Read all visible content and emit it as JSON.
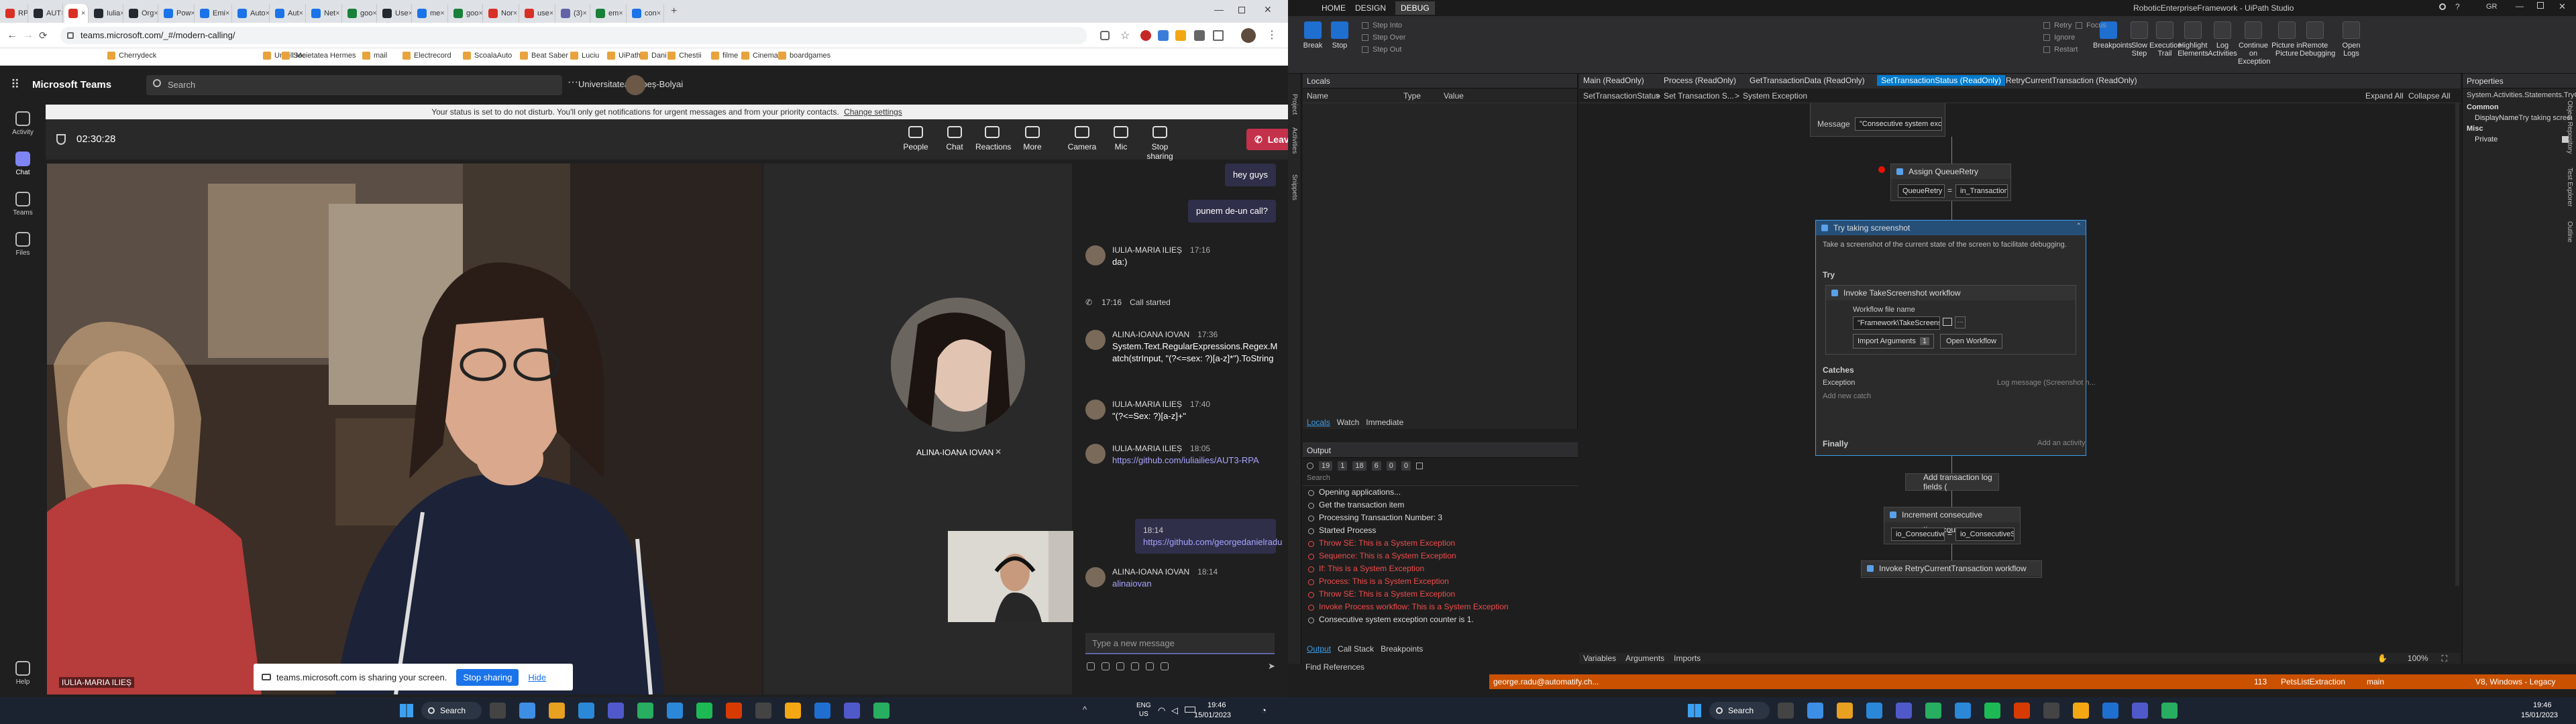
{
  "browser": {
    "tabs": [
      {
        "label": "RPA",
        "color": "#d93025"
      },
      {
        "label": "AUT",
        "color": "#24292f"
      },
      {
        "label": "",
        "color": "#d93025"
      },
      {
        "label": "Iulia",
        "color": "#24292f"
      },
      {
        "label": "Org",
        "color": "#24292f"
      },
      {
        "label": "Pow",
        "color": "#1a73e8"
      },
      {
        "label": "Emi",
        "color": "#1a73e8"
      },
      {
        "label": "Auto",
        "color": "#1a73e8"
      },
      {
        "label": "Aut",
        "color": "#1a73e8"
      },
      {
        "label": "Net",
        "color": "#1a73e8"
      },
      {
        "label": "goo",
        "color": "#188038"
      },
      {
        "label": "Use",
        "color": "#24292f"
      },
      {
        "label": "me",
        "color": "#1a73e8"
      },
      {
        "label": "goo",
        "color": "#188038"
      },
      {
        "label": "Nor",
        "color": "#d93025"
      },
      {
        "label": "use",
        "color": "#d93025"
      },
      {
        "label": "(3)",
        "color": "#6264a7"
      },
      {
        "label": "em",
        "color": "#188038"
      },
      {
        "label": "con",
        "color": "#1a73e8"
      }
    ],
    "url": "teams.microsoft.com/_#/modern-calling/",
    "bookmarks": [
      "Cherrydeck",
      "Unroll.Me",
      "Societatea Hermes",
      "mail",
      "Electrecord",
      "ScoalaAuto",
      "Beat Saber",
      "Luciu",
      "UiPath",
      "Dani",
      "Chestii",
      "filme",
      "Cinema",
      "boardgames"
    ]
  },
  "teams": {
    "app_name": "Microsoft Teams",
    "search_placeholder": "Search",
    "org": "Universitatea Babeș-Bolyai",
    "rail": [
      "Activity",
      "Chat",
      "Teams",
      "Files",
      "Help"
    ],
    "status_banner": "Your status is set to do not disturb. You'll only get notifications for urgent messages and from your priority contacts.",
    "status_link": "Change settings",
    "timer": "02:30:28",
    "controls": [
      "People",
      "Chat",
      "Reactions",
      "More",
      "Camera",
      "Mic",
      "Stop sharing"
    ],
    "leave_label": "Leave",
    "participant_main": "IULIA-MARIA ILIEȘ",
    "participant_side": "ALINA-IOANA IOVAN",
    "share_notice": "teams.microsoft.com is sharing your screen.",
    "stop_sharing": "Stop sharing",
    "hide": "Hide",
    "compose_placeholder": "Type a new message",
    "chat": [
      {
        "type": "mine",
        "text": "hey guys"
      },
      {
        "type": "mine",
        "text": "punem de-un call?"
      },
      {
        "type": "msg",
        "author": "IULIA-MARIA ILIEȘ",
        "time": "17:16",
        "text": "da:)"
      },
      {
        "type": "event",
        "time": "17:16",
        "text": "Call started"
      },
      {
        "type": "msg",
        "author": "ALINA-IOANA IOVAN",
        "time": "17:36",
        "text": "System.Text.RegularExpressions.Regex.Match(strInput, \"(?<=sex: ?)[a-z]*\").ToString"
      },
      {
        "type": "msg",
        "author": "IULIA-MARIA ILIEȘ",
        "time": "17:40",
        "text": "\"(?<=Sex: ?)[a-z]+\""
      },
      {
        "type": "msg",
        "author": "IULIA-MARIA ILIEȘ",
        "time": "18:05",
        "text": "https://github.com/iuliailies/AUT3-RPA"
      },
      {
        "type": "mine",
        "time": "18:14",
        "text": "https://github.com/georgedanielradu"
      },
      {
        "type": "msg",
        "author": "ALINA-IOANA IOVAN",
        "time": "18:14",
        "text": "alinaiovan"
      }
    ],
    "taskbar": {
      "search": "Search",
      "lang": "ENG\nUS",
      "time": "19:46",
      "date": "15/01/2023"
    }
  },
  "studio": {
    "title": "RoboticEnterpriseFramework - UiPath Studio",
    "ribbon_tabs": [
      "HOME",
      "DESIGN",
      "DEBUG"
    ],
    "buttons": [
      "Break",
      "Stop",
      "Step Into",
      "Step Over",
      "Step Out",
      "Retry",
      "Ignore",
      "Restart",
      "Focus",
      "Breakpoints",
      "Slow Step",
      "Execution Trail",
      "Highlight Elements",
      "Log Activities",
      "Continue on Exception",
      "Picture in Picture",
      "Remote Debugging",
      "Open Logs"
    ],
    "locals_title": "Locals",
    "locals_cols": [
      "Name",
      "Type",
      "Value"
    ],
    "locals_tabs": [
      "Locals",
      "Watch",
      "Immediate"
    ],
    "output_title": "Output",
    "output_counts": [
      "19",
      "1",
      "18",
      "6",
      "0",
      "0"
    ],
    "output_search": "Search",
    "output_lines": [
      {
        "t": "Opening applications...",
        "err": false
      },
      {
        "t": "Get the transaction item",
        "err": false
      },
      {
        "t": "Processing Transaction Number: 3",
        "err": false
      },
      {
        "t": "Started Process",
        "err": false
      },
      {
        "t": "Throw SE: This is a System Exception",
        "err": true
      },
      {
        "t": "Sequence: This is a System Exception",
        "err": true
      },
      {
        "t": "If: This is a System Exception",
        "err": true
      },
      {
        "t": "Process: This is a System Exception",
        "err": true
      },
      {
        "t": "Throw SE: This is a System Exception",
        "err": true
      },
      {
        "t": "Invoke Process workflow: This is a System Exception",
        "err": true
      },
      {
        "t": "Consecutive system exception counter is 1.",
        "err": false
      }
    ],
    "output_bottom_tabs": [
      "Output",
      "Call Stack",
      "Breakpoints"
    ],
    "find_refs": "Find References",
    "doc_tabs": [
      "Main (ReadOnly)",
      "Process (ReadOnly)",
      "GetTransactionData (ReadOnly)",
      "SetTransactionStatus (ReadOnly)",
      "RetryCurrentTransaction (ReadOnly)"
    ],
    "crumbs": [
      "SetTransactionStatus",
      "Set Transaction S...",
      "System Exception"
    ],
    "expand_all": "Expand All",
    "collapse_all": "Collapse All",
    "message_label": "Message",
    "message_value": "\"Consecutive system exception counter is",
    "assign_title": "Assign QueueRetry",
    "assign_left": "QueueRetry",
    "assign_right": "in_TransactionItem",
    "try_title": "Try taking screenshot",
    "try_desc": "Take a screenshot of the current state of the screen to facilitate debugging.",
    "try_label": "Try",
    "invoke_title": "Invoke TakeScreenshot workflow",
    "wf_label": "Workflow file name",
    "wf_value": "\"Framework\\TakeScreenshot.xaml\"",
    "import_args": "Import Arguments",
    "import_count": "1",
    "open_wf": "Open Workflow",
    "catches": "Catches",
    "exception": "Exception",
    "log_msg": "Log message (Screenshot n...",
    "add_exception": "Add new catch",
    "finally": "Finally",
    "add_activity": "Add an activity",
    "add_log": "Add transaction log fields (",
    "increment": "Increment consecutive exceptions cou",
    "inc_left": "io_ConsecutiveSys",
    "inc_right": "io_ConsecutiveSys",
    "invoke_retry": "Invoke RetryCurrentTransaction workflow",
    "bottom_tabs": [
      "Variables",
      "Arguments",
      "Imports"
    ],
    "zoom": "100%",
    "props_title": "Properties",
    "props_type": "System.Activities.Statements.TryCatch",
    "props_common": "Common",
    "props_display": "DisplayName",
    "props_display_val": "Try taking screenshot",
    "props_misc": "Misc",
    "props_private": "Private",
    "status_bar": [
      "george.radu@automatify.ch...",
      "113",
      "PetsListExtraction",
      "main",
      "V8, Windows - Legacy"
    ],
    "taskbar": {
      "search": "Search",
      "time": "19:46",
      "date": "15/01/2023"
    }
  }
}
